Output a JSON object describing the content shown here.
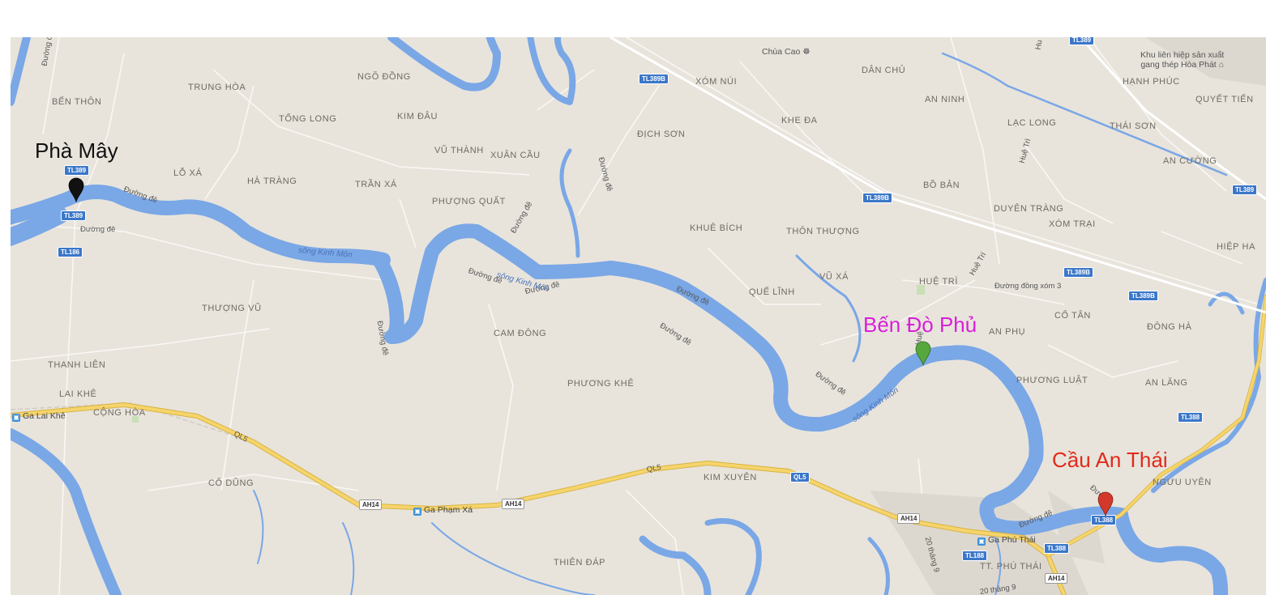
{
  "annotations": {
    "pha_may": {
      "label": "Phà Mây",
      "color": "#111111"
    },
    "ben_do_phu": {
      "label": "Bến Đò Phủ",
      "color": "#d81fd8"
    },
    "cau_an_thai": {
      "label": "Cầu An Thái",
      "color": "#e12a1a"
    }
  },
  "markers": {
    "pha_may": {
      "color": "#111111"
    },
    "ben_do_phu": {
      "color": "#56a83c"
    },
    "cau_an_thai": {
      "color": "#d2392b"
    }
  },
  "places": {
    "ben_thon": "BẾN THÔN",
    "trung_hoa": "TRUNG HÒA",
    "ngo_dong": "NGÕ ĐỒNG",
    "tong_long": "TỐNG LONG",
    "kim_dau": "KIM ĐÂU",
    "vu_thanh": "VŨ THÀNH",
    "xuan_cau": "XUÂN CẦU",
    "lo_xa": "LỖ XÁ",
    "ha_trang": "HÀ TRÀNG",
    "tran_xa": "TRẦN XÁ",
    "phuong_quat": "PHƯỢNG QUẤT",
    "xom_nui": "XÓM NÚI",
    "dich_son": "ĐỊCH SƠN",
    "dan_chu": "DÂN CHỦ",
    "an_ninh": "AN NINH",
    "khe_da": "KHE ĐA",
    "lac_long": "LẠC LONG",
    "hanh_phuc": "HẠNH PHÚC",
    "quyet_tien": "QUYẾT TIẾN",
    "thai_son": "THÁI SƠN",
    "an_cuong": "AN CƯỜNG",
    "bo_ban": "BỒ BẢN",
    "duyen_trang": "DUYÊN TRÀNG",
    "xom_trai": "XÓM TRẠI",
    "hiep_ha": "HIỆP HA",
    "khue_bich": "KHUÊ BÍCH",
    "thon_thuong": "THÔN THƯỢNG",
    "vu_xa": "VŨ XÁ",
    "que_linh": "QUẾ LĨNH",
    "hue_tri": "HUỆ TRÌ",
    "thuong_vu": "THƯỢNG VŨ",
    "cam_dong": "CAM ĐÔNG",
    "an_phu": "AN PHỤ",
    "co_tan": "CỔ TÂN",
    "dong_ha": "ĐÔNG HÀ",
    "thanh_lien": "THANH LIÊN",
    "lai_khe": "LAI KHÊ",
    "cong_hoa": "CỘNG HÒA",
    "phuong_khe": "PHƯƠNG KHÊ",
    "phuong_luat": "PHƯƠNG LUẬT",
    "an_lang": "AN LĂNG",
    "co_dung": "CỔ DŨNG",
    "kim_xuyen": "KIM XUYÊN",
    "nguu_uyen": "NGƯU UYÊN",
    "thien_dap": "THIÊN ĐÁP",
    "tt_phu_thai": "TT. PHÚ THÁI"
  },
  "pois": {
    "chua_cao": "Chùa Cao",
    "hoa_phat_line1": "Khu liên hiệp sản xuất",
    "hoa_phat_line2": "gang thép Hòa Phát"
  },
  "stations": {
    "ga_lai_khe": "Ga Lai Khê",
    "ga_pham_xa": "Ga Phạm Xá",
    "ga_phu_thai": "Ga Phú Thái"
  },
  "shields": {
    "tl389": "TL389",
    "tl389b": "TL389B",
    "tl186": "TL186",
    "tl388": "TL388",
    "tl188": "TL188",
    "ql5": "QL5",
    "ah14": "AH14"
  },
  "road_labels": {
    "duong_de": "Đường đê",
    "duong_dong_xom3": "Đường đồng xóm 3",
    "hue_tri": "Huệ Trì",
    "ql5": "QL5",
    "hai_muoi_thang_9": "20 tháng 9",
    "hu": "Hu",
    "duon": "Đườn",
    "hue": "Huệ",
    "hue_tri_2": "Huệ Trì"
  },
  "river_labels": {
    "song_kinh_mon": "sông Kinh Môn"
  },
  "colors": {
    "land": "#e8e4dc",
    "water": "#7aa7e6",
    "major_road": "#f5d56b",
    "major_road_edge": "#d9b243",
    "minor_road": "#ffffff"
  }
}
